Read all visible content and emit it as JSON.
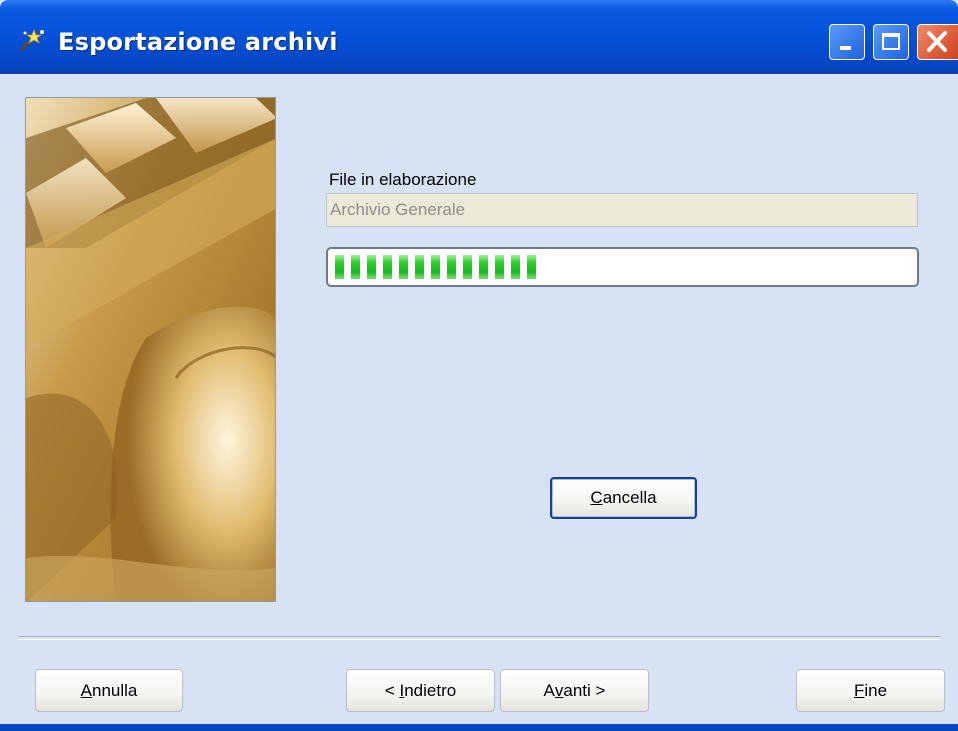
{
  "window": {
    "title": "Esportazione archivi"
  },
  "form": {
    "file_label": "File in elaborazione",
    "file_value": "Archivio Generale",
    "progress_fraction": 0.36,
    "progress_segments": 13
  },
  "buttons": {
    "cancella": {
      "underline": "C",
      "rest": "ancella"
    },
    "annulla": {
      "underline": "A",
      "rest": "nnulla"
    },
    "indietro": {
      "pre": "< ",
      "underline": "I",
      "rest": "ndietro"
    },
    "avanti": {
      "pre": "A",
      "underline": "v",
      "rest": "anti >"
    },
    "fine": {
      "underline": "F",
      "rest": "ine"
    }
  },
  "icons": {
    "app": "wizard-wand-icon",
    "minimize": "minimize-icon",
    "maximize": "maximize-icon",
    "close": "close-icon"
  },
  "colors": {
    "titlebar": "#0551d8",
    "progress_fill": "#22c422"
  }
}
